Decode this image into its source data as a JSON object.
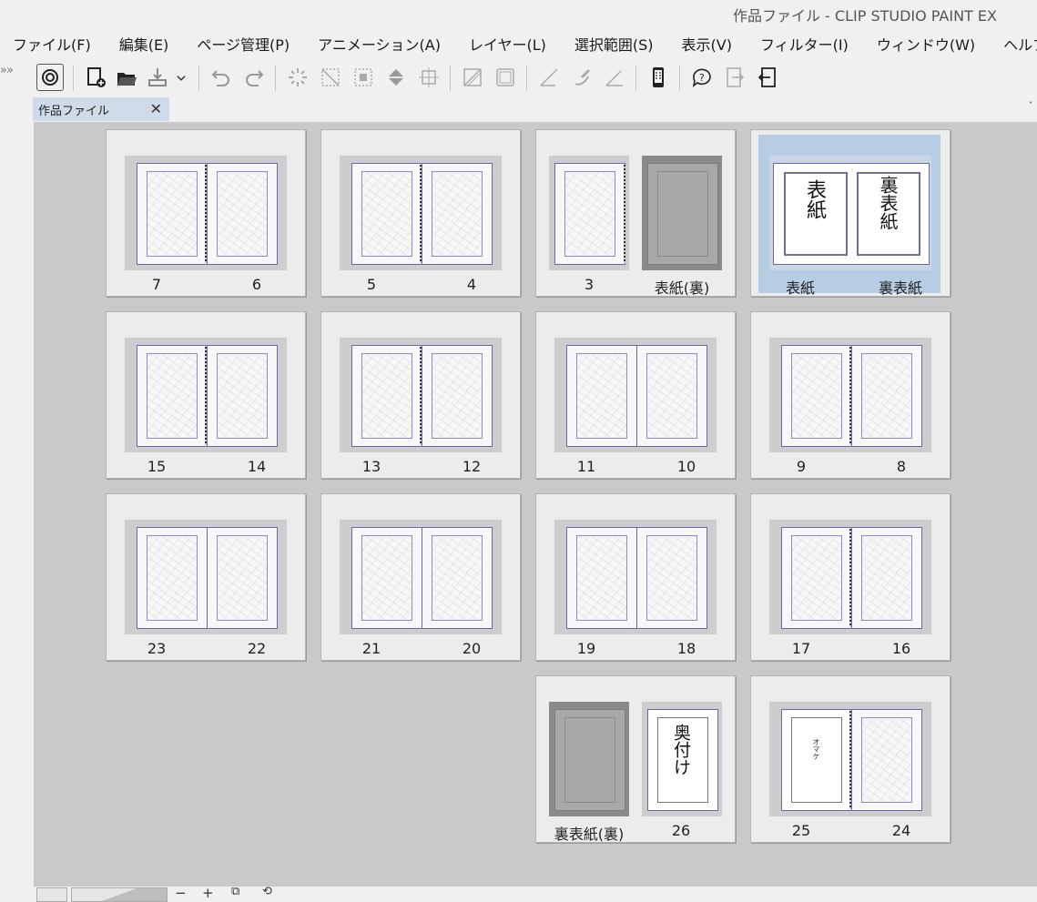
{
  "window": {
    "title": "作品ファイル - CLIP STUDIO PAINT EX"
  },
  "menu": [
    "ファイル(F)",
    "編集(E)",
    "ページ管理(P)",
    "アニメーション(A)",
    "レイヤー(L)",
    "選択範囲(S)",
    "表示(V)",
    "フィルター(I)",
    "ウィンドウ(W)",
    "ヘルプ(H)"
  ],
  "toolbar": {
    "side_arrows": "»»",
    "buttons": [
      "clip-studio-icon",
      "new-file-icon",
      "open-file-icon",
      "export-icon",
      "dropdown-chevron-icon",
      "undo-icon",
      "redo-icon",
      "clear-icon",
      "deselect-icon",
      "select-area-icon",
      "fill-icon",
      "transform-icon",
      "show-selection-icon",
      "select-all-icon",
      "ruler-icon",
      "pen-ruler-icon",
      "line-icon",
      "smartphone-icon",
      "help-icon",
      "export-page-icon",
      "import-page-icon"
    ]
  },
  "tab": {
    "label": "作品ファイル",
    "close": "✕",
    "dropdown": "ˇ"
  },
  "spreads": [
    {
      "left": "7",
      "right": "6"
    },
    {
      "left": "5",
      "right": "4"
    },
    {
      "left": "3",
      "right": "表紙(裏)"
    },
    {
      "left": "表紙",
      "right": "裏表紙",
      "selected": true
    },
    {
      "left": "15",
      "right": "14"
    },
    {
      "left": "13",
      "right": "12"
    },
    {
      "left": "11",
      "right": "10"
    },
    {
      "left": "9",
      "right": "8"
    },
    {
      "left": "23",
      "right": "22"
    },
    {
      "left": "21",
      "right": "20"
    },
    {
      "left": "19",
      "right": "18"
    },
    {
      "left": "17",
      "right": "16"
    },
    {
      "left": "裏表紙(裏)",
      "right": "26"
    },
    {
      "left": "25",
      "right": "24"
    }
  ],
  "cover_text": {
    "front": "表紙",
    "back": "裏表紙",
    "colophon": "奥付け",
    "omake": "オマケ"
  },
  "status": {
    "zoom_out": "−",
    "zoom_in": "+"
  }
}
